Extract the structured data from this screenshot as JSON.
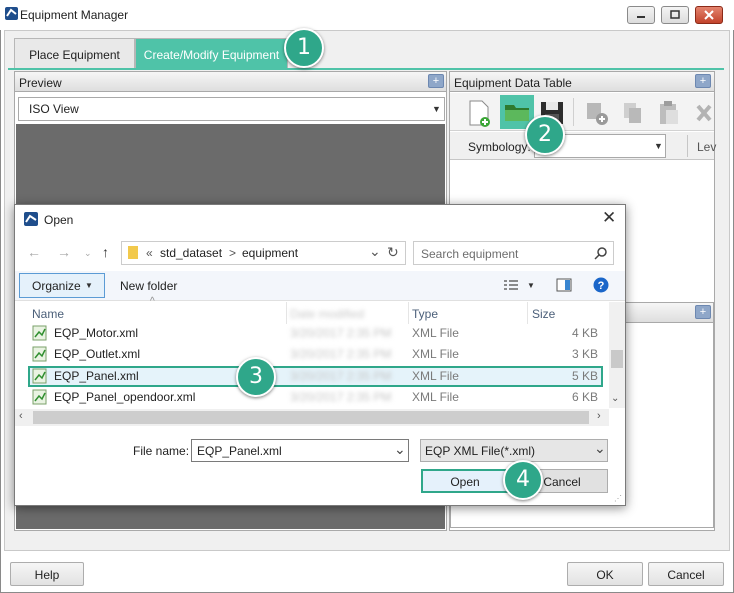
{
  "window": {
    "title": "Equipment Manager"
  },
  "tabs": [
    {
      "label": "Place Equipment"
    },
    {
      "label": "Create/Modify Equipment"
    }
  ],
  "preview": {
    "header": "Preview",
    "view": "ISO View"
  },
  "data_table": {
    "header": "Equipment Data Table",
    "symbology_label": "Symbology:",
    "level_label": "Lev"
  },
  "footer": {
    "help": "Help",
    "ok": "OK",
    "cancel": "Cancel"
  },
  "open_dialog": {
    "title": "Open",
    "breadcrumb": {
      "prefix": "«",
      "folder": "std_dataset",
      "sep": ">",
      "subfolder": "equipment"
    },
    "search_placeholder": "Search equipment",
    "organize": "Organize",
    "new_folder": "New folder",
    "columns": {
      "name": "Name",
      "date": "Date modified",
      "type": "Type",
      "size": "Size"
    },
    "files": [
      {
        "name": "EQP_Motor.xml",
        "date": "3/20/2017 2:35 PM",
        "type": "XML File",
        "size": "4 KB"
      },
      {
        "name": "EQP_Outlet.xml",
        "date": "3/20/2017 2:35 PM",
        "type": "XML File",
        "size": "3 KB"
      },
      {
        "name": "EQP_Panel.xml",
        "date": "3/20/2017 2:35 PM",
        "type": "XML File",
        "size": "5 KB"
      },
      {
        "name": "EQP_Panel_opendoor.xml",
        "date": "3/20/2017 2:35 PM",
        "type": "XML File",
        "size": "6 KB"
      }
    ],
    "file_name_label": "File name:",
    "file_name_value": "EQP_Panel.xml",
    "file_type": "EQP XML File(*.xml)",
    "open_button": "Open",
    "cancel_button": "Cancel"
  },
  "callouts": [
    "1",
    "2",
    "3",
    "4"
  ],
  "colors": {
    "accent": "#4fc3a8",
    "callout": "#2fa78a",
    "preview_bg": "#6b6b6b"
  }
}
